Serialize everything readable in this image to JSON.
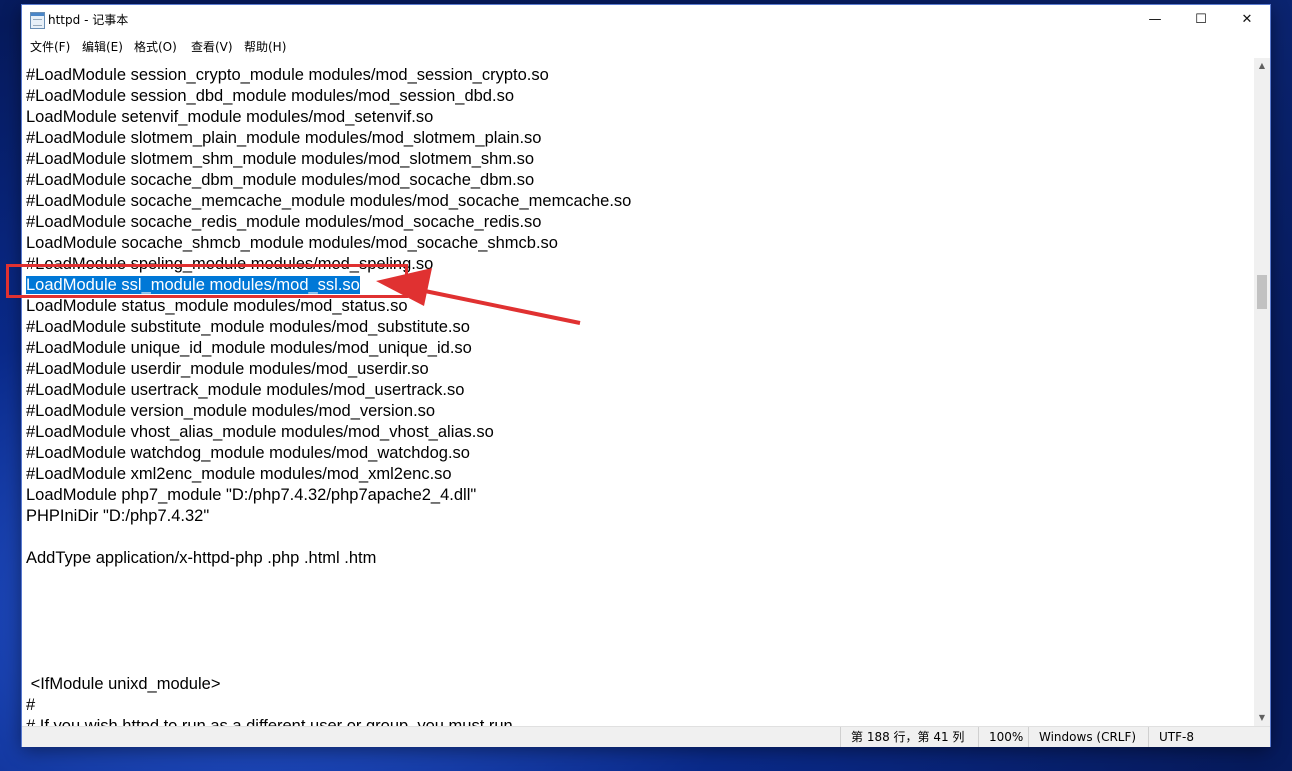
{
  "window": {
    "title": "httpd - 记事本",
    "controls": {
      "minimize": "—",
      "maximize": "☐",
      "close": "✕"
    }
  },
  "menu": {
    "items": [
      "文件(F)",
      "编辑(E)",
      "格式(O)",
      "查看(V)",
      "帮助(H)"
    ]
  },
  "editor": {
    "lines": [
      "#LoadModule session_crypto_module modules/mod_session_crypto.so",
      "#LoadModule session_dbd_module modules/mod_session_dbd.so",
      "LoadModule setenvif_module modules/mod_setenvif.so",
      "#LoadModule slotmem_plain_module modules/mod_slotmem_plain.so",
      "#LoadModule slotmem_shm_module modules/mod_slotmem_shm.so",
      "#LoadModule socache_dbm_module modules/mod_socache_dbm.so",
      "#LoadModule socache_memcache_module modules/mod_socache_memcache.so",
      "#LoadModule socache_redis_module modules/mod_socache_redis.so",
      "LoadModule socache_shmcb_module modules/mod_socache_shmcb.so",
      "#LoadModule speling_module modules/mod_speling.so",
      "LoadModule ssl_module modules/mod_ssl.so",
      "LoadModule status_module modules/mod_status.so",
      "#LoadModule substitute_module modules/mod_substitute.so",
      "#LoadModule unique_id_module modules/mod_unique_id.so",
      "#LoadModule userdir_module modules/mod_userdir.so",
      "#LoadModule usertrack_module modules/mod_usertrack.so",
      "#LoadModule version_module modules/mod_version.so",
      "#LoadModule vhost_alias_module modules/mod_vhost_alias.so",
      "#LoadModule watchdog_module modules/mod_watchdog.so",
      "#LoadModule xml2enc_module modules/mod_xml2enc.so",
      "LoadModule php7_module \"D:/php7.4.32/php7apache2_4.dll\"",
      "PHPIniDir \"D:/php7.4.32\"",
      "",
      "AddType application/x-httpd-php .php .html .htm",
      "",
      "",
      "",
      "",
      "",
      " <IfModule unixd_module>",
      "#",
      "# If you wish httpd to run as a different user or group, you must run"
    ],
    "selected_line": "LoadModule ssl_module modules/mod_ssl.so"
  },
  "statusbar": {
    "position": "第 188 行，第 41 列",
    "zoom": "100%",
    "line_ending": "Windows (CRLF)",
    "encoding": "UTF-8"
  },
  "colors": {
    "selection": "#0078d7",
    "annotation": "#e03131"
  }
}
